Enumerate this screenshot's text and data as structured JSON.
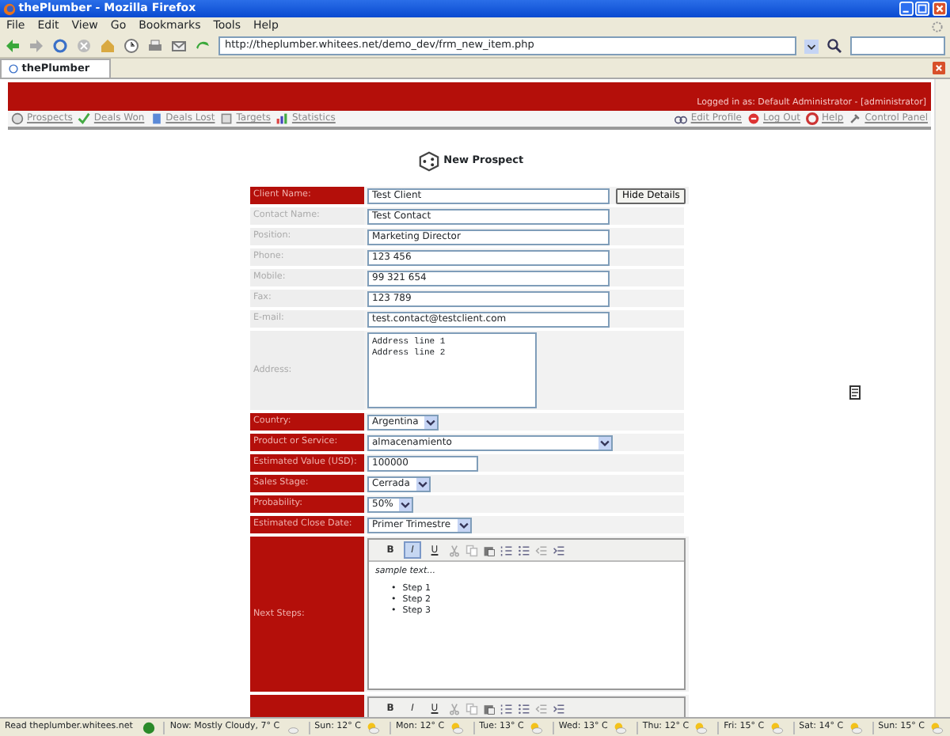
{
  "window": {
    "title": "thePlumber - Mozilla Firefox"
  },
  "menu": [
    "File",
    "Edit",
    "View",
    "Go",
    "Bookmarks",
    "Tools",
    "Help"
  ],
  "address_bar": {
    "value": "http://theplumber.whitees.net/demo_dev/frm_new_item.php"
  },
  "tabs": [
    {
      "label": "thePlumber",
      "selected": true
    }
  ],
  "header": {
    "login": "Logged in as: Default Administrator - [administrator]"
  },
  "nav_left": [
    "Prospects",
    "Deals Won",
    "Deals Lost",
    "Targets",
    "Statistics"
  ],
  "nav_right": [
    "Edit Profile",
    "Log Out",
    "Help",
    "Control Panel"
  ],
  "page_title": "New Prospect",
  "form": [
    {
      "label": "Client Name:",
      "required": true,
      "kind": "text",
      "value": "Test Client",
      "button": "Hide Details"
    },
    {
      "label": "Contact Name:",
      "required": false,
      "kind": "text",
      "value": "Test Contact"
    },
    {
      "label": "Position:",
      "required": false,
      "kind": "text",
      "value": "Marketing Director"
    },
    {
      "label": "Phone:",
      "required": false,
      "kind": "text",
      "value": "123 456"
    },
    {
      "label": "Mobile:",
      "required": false,
      "kind": "text",
      "value": "99 321 654"
    },
    {
      "label": "Fax:",
      "required": false,
      "kind": "text",
      "value": "123 789"
    },
    {
      "label": "E-mail:",
      "required": false,
      "kind": "text",
      "value": "test.contact@testclient.com"
    },
    {
      "label": "Address:",
      "required": false,
      "kind": "textarea",
      "value": "Address line 1\nAddress line 2"
    },
    {
      "label": "Country:",
      "required": true,
      "kind": "select",
      "value": "Argentina"
    },
    {
      "label": "Product or Service:",
      "required": true,
      "kind": "wide-select",
      "value": "almacenamiento"
    },
    {
      "label": "Estimated Value (USD):",
      "required": true,
      "kind": "short-text",
      "value": "100000"
    },
    {
      "label": "Sales Stage:",
      "required": true,
      "kind": "select",
      "value": "Cerrada"
    },
    {
      "label": "Probability:",
      "required": true,
      "kind": "select",
      "value": "50%"
    },
    {
      "label": "Estimated Close Date:",
      "required": true,
      "kind": "select",
      "value": "Primer Trimestre"
    },
    {
      "label": "Next Steps:",
      "required": true,
      "kind": "editor",
      "format": [
        {
          "label": "B",
          "active": false
        },
        {
          "label": "I",
          "active": true
        },
        {
          "label": "U",
          "active": false
        }
      ],
      "intro": "sample text...",
      "items": [
        {
          "bullet": "•",
          "text": "Step 1"
        },
        {
          "bullet": "•",
          "text": "Step 2"
        },
        {
          "bullet": "•",
          "text": "Step 3"
        }
      ]
    },
    {
      "required": true,
      "kind": "editor-cut",
      "format": [
        {
          "label": "B",
          "active": false
        },
        {
          "label": "I",
          "active": false
        },
        {
          "label": "U",
          "active": false
        }
      ]
    }
  ],
  "status_bar": {
    "text": "Read theplumber.whitees.net",
    "weather": [
      "Now: Mostly Cloudy, 7° C",
      "Sun: 12° C",
      "Mon: 12° C",
      "Tue: 13° C",
      "Wed: 13° C",
      "Thu: 12° C",
      "Fri: 15° C",
      "Sat: 14° C",
      "Sun: 15° C"
    ]
  }
}
